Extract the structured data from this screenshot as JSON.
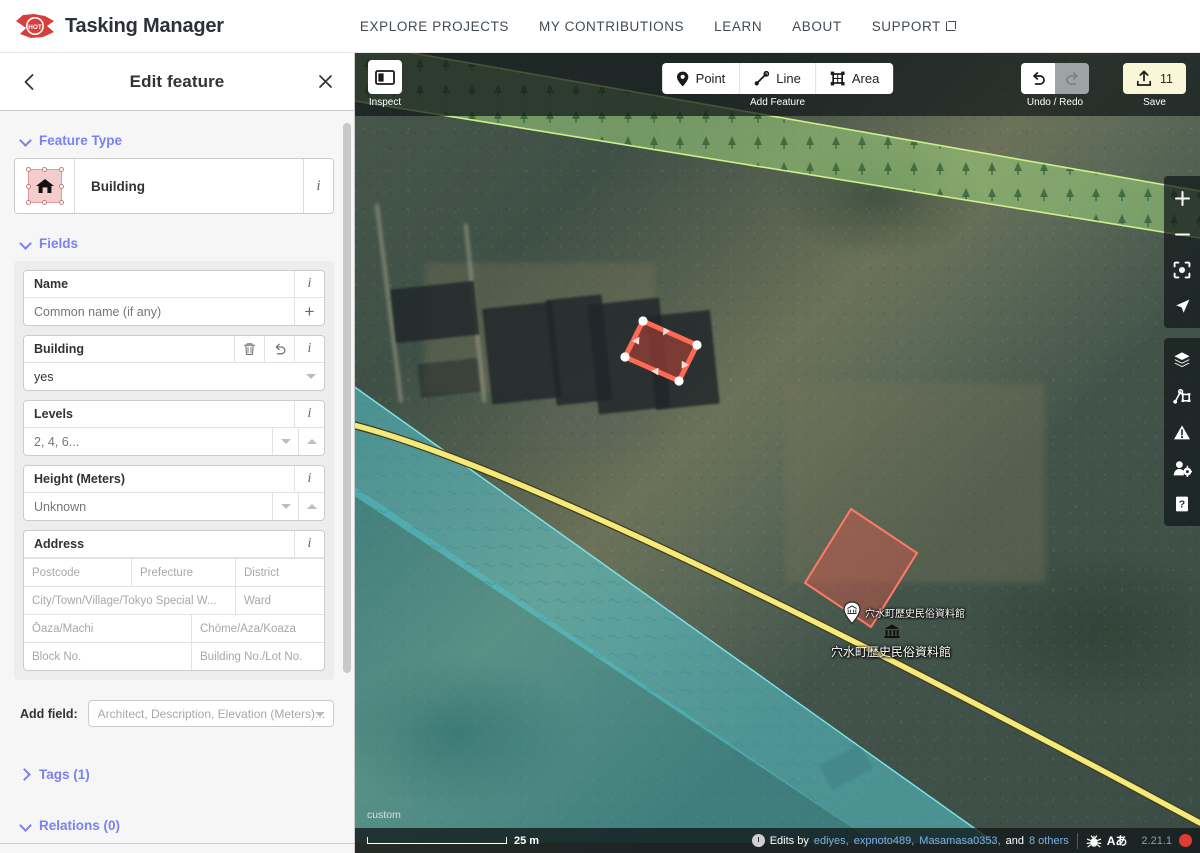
{
  "topnav": {
    "brand_title": "Tasking Manager",
    "logo_text": "HOT",
    "links": [
      {
        "label": "EXPLORE PROJECTS",
        "external": false
      },
      {
        "label": "MY CONTRIBUTIONS",
        "external": false
      },
      {
        "label": "LEARN",
        "external": false
      },
      {
        "label": "ABOUT",
        "external": false
      },
      {
        "label": "SUPPORT",
        "external": true
      }
    ]
  },
  "sidebar": {
    "title": "Edit feature",
    "back_icon": "chevron-left-icon",
    "close_icon": "close-icon",
    "feature_type": {
      "section_label": "Feature Type",
      "expanded": true,
      "name": "Building",
      "icon": "building-house-icon",
      "info_label": "i"
    },
    "fields": {
      "section_label": "Fields",
      "expanded": true,
      "items": [
        {
          "label": "Name",
          "value": "",
          "placeholder": "Common name (if any)",
          "buttons": [
            "info"
          ],
          "trailing": "plus"
        },
        {
          "label": "Building",
          "value": "yes",
          "placeholder": "",
          "buttons": [
            "trash",
            "undo",
            "info"
          ],
          "trailing": "caret-down"
        },
        {
          "label": "Levels",
          "value": "",
          "placeholder": "2, 4, 6...",
          "buttons": [
            "info"
          ],
          "trailing": "stepper"
        },
        {
          "label": "Height (Meters)",
          "value": "",
          "placeholder": "Unknown",
          "buttons": [
            "info"
          ],
          "trailing": "stepper"
        }
      ],
      "address": {
        "label": "Address",
        "buttons": [
          "info"
        ],
        "rows": [
          [
            {
              "placeholder": "Postcode",
              "combo": true
            },
            {
              "placeholder": "Prefecture",
              "combo": true
            },
            {
              "placeholder": "District",
              "combo": true
            }
          ],
          [
            {
              "placeholder": "City/Town/Village/Tokyo Special W...",
              "combo": true
            },
            {
              "placeholder": "Ward",
              "combo": true
            }
          ],
          [
            {
              "placeholder": "Ōaza/Machi",
              "combo": true
            },
            {
              "placeholder": "Chōme/Aza/Koaza",
              "combo": true
            }
          ],
          [
            {
              "placeholder": "Block No.",
              "combo": true
            },
            {
              "placeholder": "Building No./Lot No.",
              "combo": false
            }
          ]
        ]
      }
    },
    "add_field": {
      "label": "Add field:",
      "placeholder": "Architect, Description, Elevation (Meters)..."
    },
    "tags": {
      "label": "Tags (1)",
      "expanded": false
    },
    "relations": {
      "label": "Relations (0)",
      "expanded": true
    }
  },
  "map_toolbar": {
    "inspect": {
      "label": "Inspect",
      "icon": "inspect-panel-icon",
      "active": false
    },
    "add_feature": {
      "group_label": "Add Feature",
      "buttons": [
        {
          "label": "Point",
          "icon": "map-pin-icon"
        },
        {
          "label": "Line",
          "icon": "line-segment-icon"
        },
        {
          "label": "Area",
          "icon": "area-polygon-icon"
        }
      ]
    },
    "undo_redo": {
      "group_label": "Undo / Redo",
      "undo": {
        "icon": "undo-arrow-icon",
        "enabled": true
      },
      "redo": {
        "icon": "redo-arrow-icon",
        "enabled": false
      }
    },
    "save": {
      "label": "Save",
      "icon": "save-upload-icon",
      "count": "11",
      "background": "#faf6d8"
    }
  },
  "map_rail": {
    "group_one": [
      {
        "name": "zoom-in",
        "glyph": "+"
      },
      {
        "name": "zoom-out",
        "glyph": "−"
      },
      {
        "name": "zoom-to-selection",
        "glyph": "crosshair"
      },
      {
        "name": "geolocate",
        "glyph": "arrow"
      }
    ],
    "group_two": [
      {
        "name": "background-settings",
        "glyph": "layers"
      },
      {
        "name": "map-data",
        "glyph": "map-data"
      },
      {
        "name": "issues",
        "glyph": "warning"
      },
      {
        "name": "preferences",
        "glyph": "user-gear"
      },
      {
        "name": "help",
        "glyph": "help"
      }
    ]
  },
  "map_footer": {
    "basemap_name": "custom",
    "scale": "25 m",
    "edits_by_prefix": "Edits by",
    "editors": [
      "ediyes",
      "expnoto489",
      "Masamasa0353"
    ],
    "edits_by_suffix_pre": "and",
    "others_count": "8 others",
    "language_icons": [
      "bug-icon",
      "translate-icon"
    ],
    "version": "2.21.1"
  },
  "map_features": {
    "selected_polygon": {
      "name": "selected-building",
      "fill": "#e04a3c",
      "stroke": "#ff6a55"
    },
    "museum_polygon": {
      "name": "museum-building",
      "fill": "#e0564a"
    },
    "labels": [
      {
        "text": "穴水町歴史民俗資料館",
        "kind": "poi-pin-label"
      },
      {
        "text": "穴水町歴史民俗資料館",
        "kind": "area-label"
      }
    ],
    "road_color": "#f5e97a",
    "wood_color": "#8ccf6b",
    "water_color": "#5fd2d8"
  },
  "colors": {
    "accent_purple": "#7a81f0",
    "hot_red": "#d73f3f",
    "save_bg": "#faf6d8",
    "link_blue": "#7db0e8"
  }
}
